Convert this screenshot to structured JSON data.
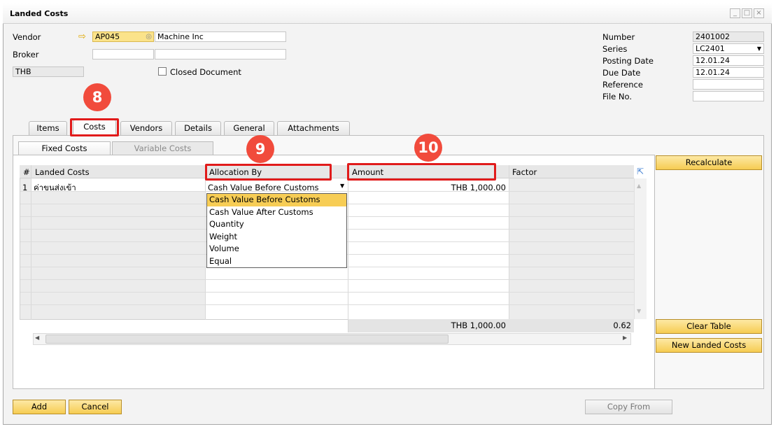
{
  "window": {
    "title": "Landed Costs",
    "controls": [
      "_",
      "□",
      "×"
    ]
  },
  "header": {
    "vendor_label": "Vendor",
    "vendor_code": "AP045",
    "vendor_name": "Machine Inc",
    "broker_label": "Broker",
    "currency": "THB",
    "closed_document_label": "Closed Document",
    "closed_document_checked": false
  },
  "doc_info": {
    "number_label": "Number",
    "number_value": "2401002",
    "series_label": "Series",
    "series_value": "LC2401",
    "posting_date_label": "Posting Date",
    "posting_date_value": "12.01.24",
    "due_date_label": "Due Date",
    "due_date_value": "12.01.24",
    "reference_label": "Reference",
    "reference_value": "",
    "file_no_label": "File No.",
    "file_no_value": ""
  },
  "annotations": {
    "badge_8": "8",
    "badge_9": "9",
    "badge_10": "10"
  },
  "tabs": [
    "Items",
    "Costs",
    "Vendors",
    "Details",
    "General",
    "Attachments"
  ],
  "active_tab": "Costs",
  "subtabs": {
    "fixed": "Fixed Costs",
    "variable": "Variable Costs"
  },
  "grid": {
    "columns": {
      "num": "#",
      "landed_costs": "Landed Costs",
      "allocation_by": "Allocation By",
      "amount": "Amount",
      "factor": "Factor"
    },
    "rows": [
      {
        "num": "1",
        "landed_costs": "ค่าขนส่งเข้า",
        "allocation_by": "Cash Value Before Customs",
        "amount": "THB 1,000.00",
        "factor": ""
      }
    ],
    "footer": {
      "amount_total": "THB 1,000.00",
      "factor_total": "0.62"
    }
  },
  "allocation_dropdown": {
    "options": [
      "Cash Value Before Customs",
      "Cash Value After Customs",
      "Quantity",
      "Weight",
      "Volume",
      "Equal"
    ],
    "selected": "Cash Value Before Customs"
  },
  "side_buttons": {
    "recalculate": "Recalculate",
    "clear_table": "Clear Table",
    "new_landed_costs": "New Landed Costs"
  },
  "footer_buttons": {
    "add": "Add",
    "cancel": "Cancel",
    "copy_from": "Copy From"
  },
  "colors": {
    "badge": "#f14b3c",
    "highlight_box": "#e11b1b",
    "button_yellow": "#f6cc52",
    "dropdown_selected": "#f7cd55"
  }
}
